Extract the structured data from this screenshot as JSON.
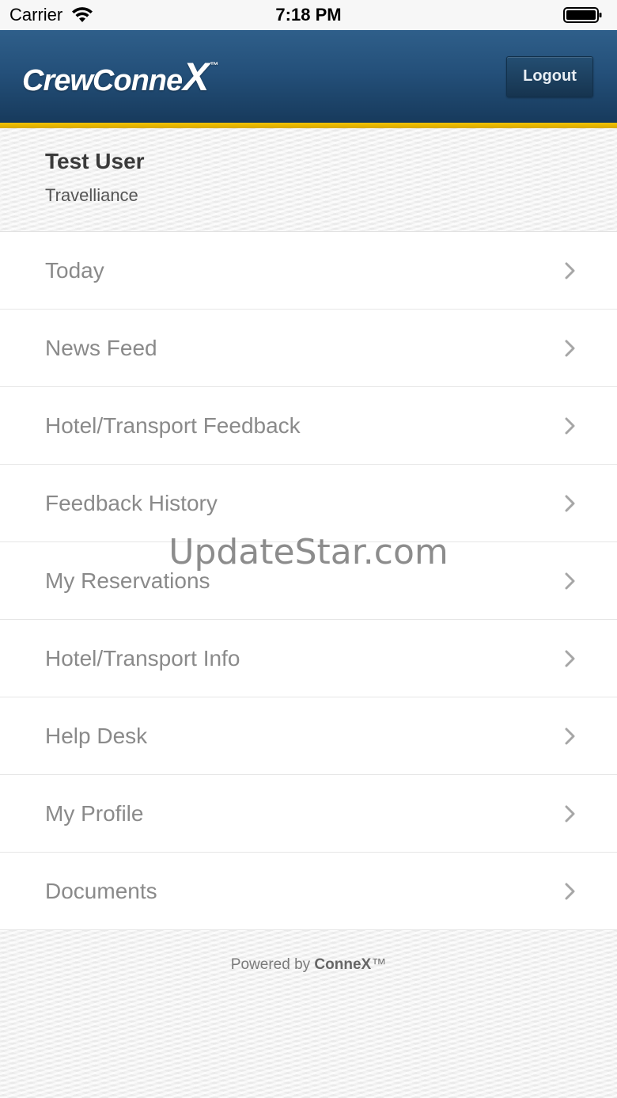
{
  "status_bar": {
    "carrier": "Carrier",
    "time": "7:18 PM"
  },
  "header": {
    "logo_text": "CrewConne",
    "logo_x": "X",
    "logo_tm": "™",
    "logout_label": "Logout",
    "brand_color": "#24507a",
    "accent_color": "#f2c200"
  },
  "user": {
    "name": "Test User",
    "company": "Travelliance"
  },
  "menu": {
    "items": [
      {
        "label": "Today"
      },
      {
        "label": "News Feed"
      },
      {
        "label": "Hotel/Transport Feedback"
      },
      {
        "label": "Feedback History"
      },
      {
        "label": "My Reservations"
      },
      {
        "label": "Hotel/Transport Info"
      },
      {
        "label": "Help Desk"
      },
      {
        "label": "My Profile"
      },
      {
        "label": "Documents"
      }
    ]
  },
  "footer": {
    "powered_prefix": "Powered by ",
    "powered_brand": "ConneX",
    "powered_tm": "™"
  },
  "watermark": "UpdateStar.com"
}
